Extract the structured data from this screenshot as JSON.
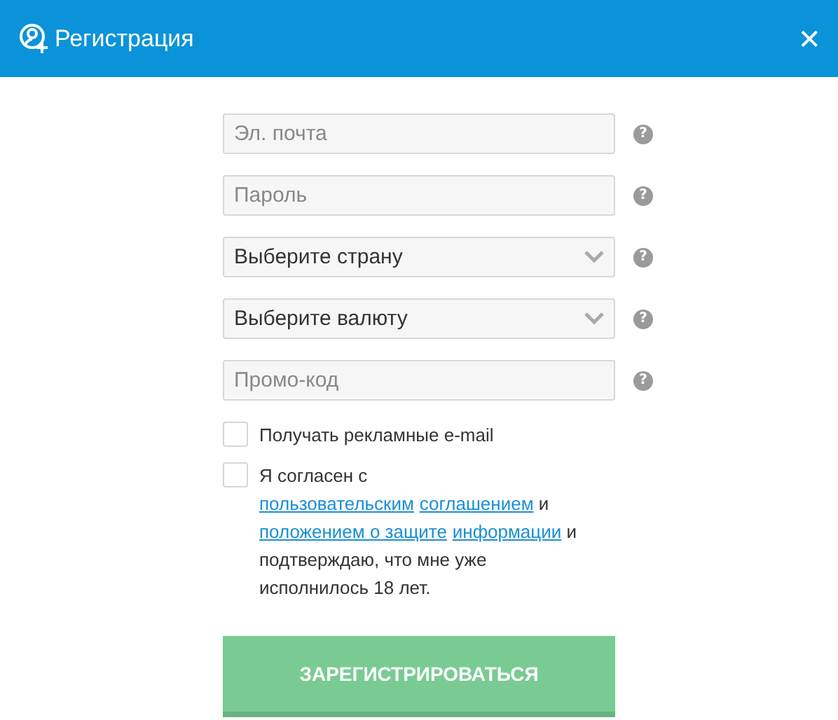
{
  "window": {
    "title": "Регистрация",
    "close": "✕"
  },
  "fields": [
    {
      "kind": "input",
      "placeholder": "Эл. почта",
      "help": "?"
    },
    {
      "kind": "input",
      "placeholder": "Пароль",
      "help": "?"
    },
    {
      "kind": "select",
      "value": "Выберите страну",
      "help": "?"
    },
    {
      "kind": "select",
      "value": "Выберите валюту",
      "help": "?"
    },
    {
      "kind": "input",
      "placeholder": "Промо-код",
      "help": "?"
    }
  ],
  "checkboxes": [
    {
      "checked": false,
      "segments": [
        {
          "kind": "text",
          "text": "Получать рекламные e-mail"
        }
      ]
    },
    {
      "checked": false,
      "segments": [
        {
          "kind": "text",
          "text": "Я согласен с "
        },
        {
          "kind": "link",
          "text": "пользовательским"
        },
        {
          "kind": "link",
          "text": "соглашением"
        },
        {
          "kind": "text",
          "text": " и "
        },
        {
          "kind": "link",
          "text": "положением о защите"
        },
        {
          "kind": "link",
          "text": "информации"
        },
        {
          "kind": "text",
          "text": " и подтверждаю, что мне уже исполнилось 18 лет."
        }
      ]
    }
  ],
  "submit": "ЗАРЕГИСТРИРОВАТЬСЯ"
}
